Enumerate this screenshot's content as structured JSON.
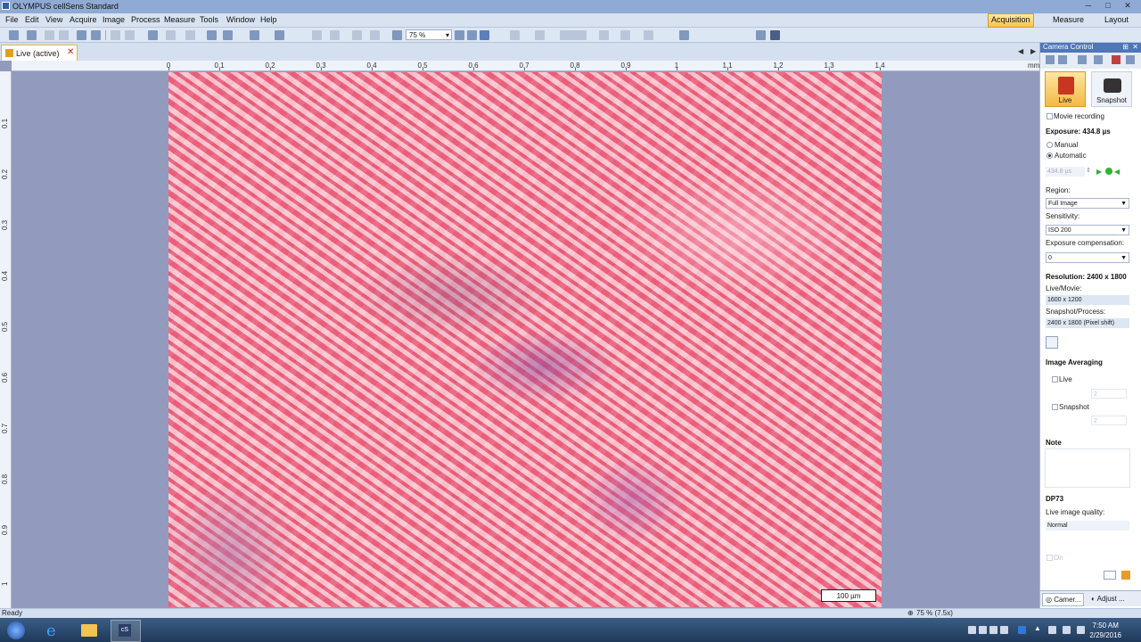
{
  "window": {
    "title": "OLYMPUS cellSens Standard"
  },
  "menu": [
    "File",
    "Edit",
    "View",
    "Acquire",
    "Image",
    "Process",
    "Measure",
    "Tools",
    "Window",
    "Help"
  ],
  "modes": {
    "acquisition": "Acquisition",
    "measure": "Measure",
    "layout": "Layout"
  },
  "toolbar": {
    "zoom": "75 %"
  },
  "document_tab": {
    "label": "Live (active)"
  },
  "ruler": {
    "h_ticks": [
      "0",
      "0.1",
      "0.2",
      "0.3",
      "0.4",
      "0.5",
      "0.6",
      "0.7",
      "0.8",
      "0.9",
      "1",
      "1.1",
      "1.2",
      "1.3",
      "1.4"
    ],
    "unit": "mm",
    "v_ticks": [
      "0.1",
      "0.2",
      "0.3",
      "0.4",
      "0.5",
      "0.6",
      "0.7",
      "0.8",
      "0.9",
      "1"
    ]
  },
  "scalebar": "100 µm",
  "status": {
    "left": "Ready",
    "zoom": "75 % (7.5x)"
  },
  "panel": {
    "title": "Camera Control",
    "live_label": "Live",
    "snapshot_label": "Snapshot",
    "movie_recording": "Movie recording",
    "exposure": "Exposure: 434.8 µs",
    "manual": "Manual",
    "automatic": "Automatic",
    "exposure_value": "434.8 µs",
    "region_label": "Region:",
    "region_value": "Full Image",
    "sensitivity_label": "Sensitivity:",
    "sensitivity_value": "ISO 200",
    "exp_comp_label": "Exposure compensation:",
    "exp_comp_value": "0",
    "resolution": "Resolution: 2400 x 1800",
    "live_movie_label": "Live/Movie:",
    "live_movie_value": "1600 x 1200",
    "snapshot_process_label": "Snapshot/Process:",
    "snapshot_process_value": "2400 x 1800 (Pixel shift)",
    "image_averaging": "Image Averaging",
    "avg_live": "Live",
    "avg_live_frames": "2",
    "avg_snapshot": "Snapshot",
    "avg_snapshot_frames": "2",
    "note": "Note",
    "dp73": "DP73",
    "live_quality_label": "Live image quality:",
    "live_quality_value": "Normal",
    "on": "On",
    "tab_camera": "Camer...",
    "tab_adjust": "Adjust ..."
  },
  "taskbar": {
    "time": "7:50 AM",
    "date": "2/29/2016"
  }
}
